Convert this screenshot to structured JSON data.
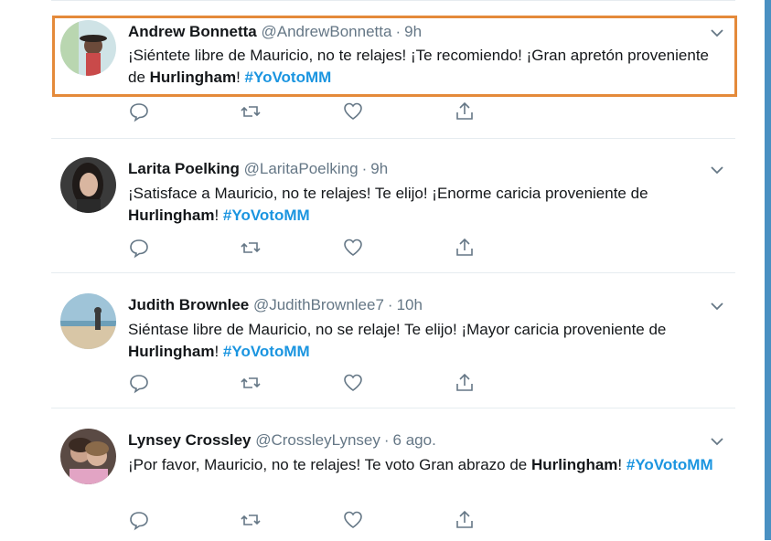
{
  "colors": {
    "hashtag": "#1b95e0",
    "muted": "#657786",
    "highlight": "#e48a3a",
    "right_bar": "#4a90c2"
  },
  "icons": {
    "reply": "reply-icon",
    "retweet": "retweet-icon",
    "like": "heart-icon",
    "share": "share-icon",
    "menu": "chevron-down-icon"
  },
  "tweets": [
    {
      "name": "Andrew Bonnetta",
      "handle": "@AndrewBonnetta",
      "sep": "·",
      "time": "9h",
      "text_a": "¡Siéntete libre de Mauricio, no te relajes! ¡Te recomiendo! ¡Gran apretón proveniente de ",
      "bold": "Hurlingham",
      "text_b": "! ",
      "hashtag": "#YoVotoMM",
      "highlighted": true
    },
    {
      "name": "Larita Poelking",
      "handle": "@LaritaPoelking",
      "sep": "·",
      "time": "9h",
      "text_a": "¡Satisface a Mauricio, no te relajes! Te elijo! ¡Enorme caricia proveniente de ",
      "bold": "Hurlingham",
      "text_b": "! ",
      "hashtag": "#YoVotoMM",
      "highlighted": false
    },
    {
      "name": "Judith Brownlee",
      "handle": "@JudithBrownlee7",
      "sep": "·",
      "time": "10h",
      "text_a": "Siéntase libre de Mauricio, no se relaje! Te elijo! ¡Mayor caricia proveniente de ",
      "bold": "Hurlingham",
      "text_b": "! ",
      "hashtag": "#YoVotoMM",
      "highlighted": false
    },
    {
      "name": "Lynsey Crossley",
      "handle": "@CrossleyLynsey",
      "sep": "·",
      "time": "6 ago.",
      "text_a": "¡Por favor, Mauricio, no te relajes! Te voto Gran abrazo de ",
      "bold": "Hurlingham",
      "text_b": "! ",
      "hashtag": "#YoVotoMM",
      "highlighted": false
    }
  ]
}
